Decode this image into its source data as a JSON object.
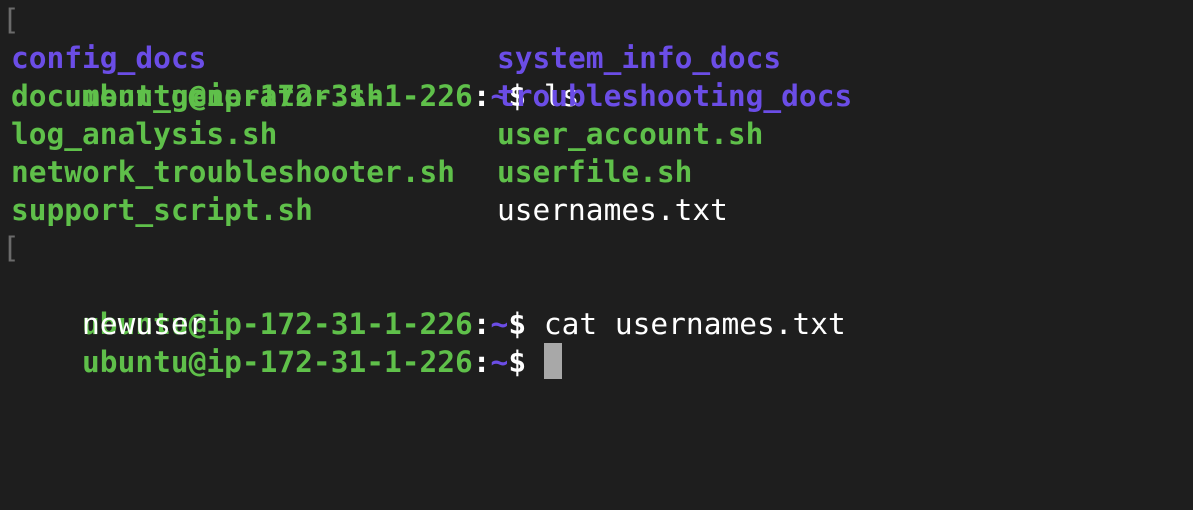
{
  "colors": {
    "background": "#1e1e1e",
    "user_host": "#5fc04a",
    "path": "#6b4de6",
    "directory": "#6b4de6",
    "executable": "#5fc04a",
    "plain": "#ffffff",
    "cursor": "#a8a8a8"
  },
  "prompt": {
    "user_host": "ubuntu@ip-172-31-1-226",
    "colon": ":",
    "path": "~",
    "symbol": "$"
  },
  "commands": {
    "first": "ls",
    "second": "cat usernames.txt"
  },
  "ls_output": {
    "left": [
      {
        "name": "config_docs",
        "kind": "directory"
      },
      {
        "name": "document_generator.sh",
        "kind": "executable"
      },
      {
        "name": "log_analysis.sh",
        "kind": "executable"
      },
      {
        "name": "network_troubleshooter.sh",
        "kind": "executable"
      },
      {
        "name": "support_script.sh",
        "kind": "executable"
      }
    ],
    "right": [
      {
        "name": "system_info_docs",
        "kind": "directory"
      },
      {
        "name": "troubleshooting_docs",
        "kind": "directory"
      },
      {
        "name": "user_account.sh",
        "kind": "executable"
      },
      {
        "name": "userfile.sh",
        "kind": "executable"
      },
      {
        "name": "usernames.txt",
        "kind": "file"
      }
    ]
  },
  "cat_output": "newuser",
  "line_marker": "["
}
